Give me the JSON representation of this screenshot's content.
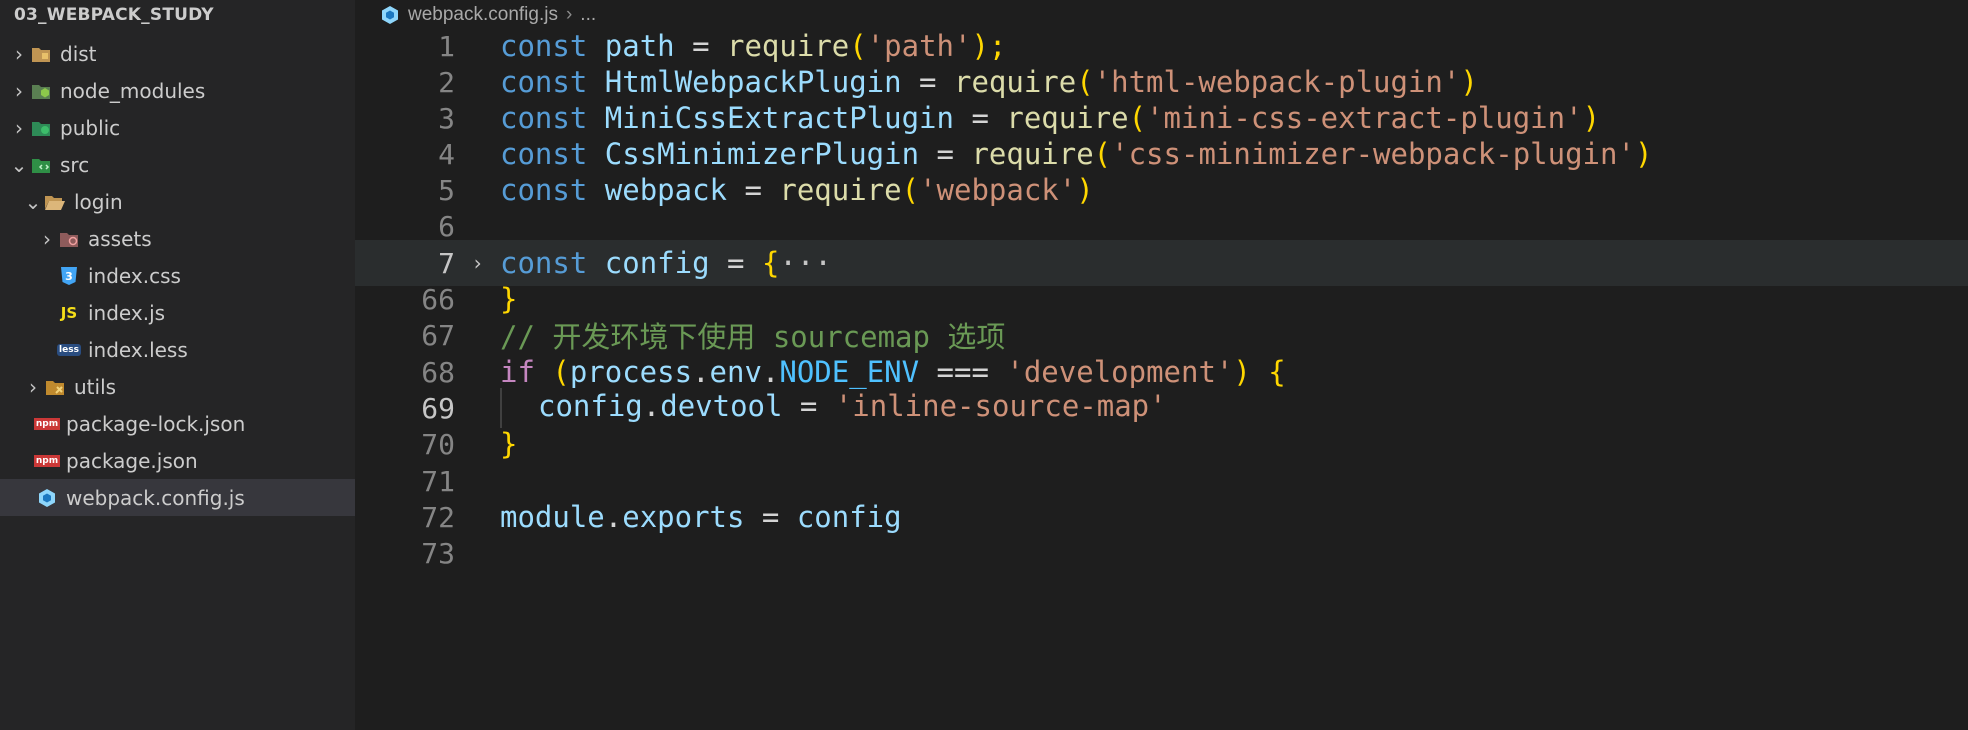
{
  "explorer": {
    "root_label": "03_WEBPACK_STUDY",
    "items": [
      {
        "label": "dist",
        "icon": "dist-folder-icon",
        "twisty": "›"
      },
      {
        "label": "node_modules",
        "icon": "node-modules-folder-icon",
        "twisty": "›"
      },
      {
        "label": "public",
        "icon": "public-folder-icon",
        "twisty": "›"
      },
      {
        "label": "src",
        "icon": "src-folder-icon",
        "twisty": "⌄"
      },
      {
        "label": "login",
        "icon": "folder-open-icon",
        "twisty": "⌄"
      },
      {
        "label": "assets",
        "icon": "assets-folder-icon",
        "twisty": "›"
      },
      {
        "label": "index.css",
        "icon": "css-file-icon",
        "icon_text": "3"
      },
      {
        "label": "index.js",
        "icon": "js-file-icon",
        "icon_text": "JS"
      },
      {
        "label": "index.less",
        "icon": "less-file-icon",
        "icon_text": "less"
      },
      {
        "label": "utils",
        "icon": "utils-folder-icon",
        "twisty": "›"
      },
      {
        "label": "package-lock.json",
        "icon": "npm-file-icon",
        "icon_text": "npm"
      },
      {
        "label": "package.json",
        "icon": "npm-file-icon",
        "icon_text": "npm"
      },
      {
        "label": "webpack.config.js",
        "icon": "webpack-file-icon"
      }
    ]
  },
  "breadcrumb": {
    "file": "webpack.config.js",
    "separator": "›",
    "more": "..."
  },
  "editor": {
    "lines": [
      {
        "num": "1",
        "t": [
          "const",
          " ",
          "path",
          " = ",
          "require",
          "(",
          "'path'",
          ");"
        ]
      },
      {
        "num": "2",
        "t": [
          "const",
          " ",
          "HtmlWebpackPlugin",
          " = ",
          "require",
          "(",
          "'html-webpack-plugin'",
          ")"
        ]
      },
      {
        "num": "3",
        "t": [
          "const",
          " ",
          "MiniCssExtractPlugin",
          " = ",
          "require",
          "(",
          "'mini-css-extract-plugin'",
          ")"
        ]
      },
      {
        "num": "4",
        "t": [
          "const",
          " ",
          "CssMinimizerPlugin",
          " = ",
          "require",
          "(",
          "'css-minimizer-webpack-plugin'",
          ")"
        ]
      },
      {
        "num": "5",
        "t": [
          "const",
          " ",
          "webpack",
          " = ",
          "require",
          "(",
          "'webpack'",
          ")"
        ]
      },
      {
        "num": "6",
        "t": []
      },
      {
        "num": "7",
        "fold": "›",
        "t": [
          "const",
          " ",
          "config",
          " = ",
          "{",
          "···"
        ]
      },
      {
        "num": "66",
        "t": [
          "}"
        ]
      },
      {
        "num": "67",
        "t": [
          "// 开发环境下使用 sourcemap 选项"
        ]
      },
      {
        "num": "68",
        "t": [
          "if",
          " (",
          "process",
          ".",
          "env",
          ".",
          "NODE_ENV",
          " === ",
          "'development'",
          ") ",
          "{"
        ]
      },
      {
        "num": "69",
        "t": [
          "config",
          ".",
          "devtool",
          " = ",
          "'inline-source-map'"
        ]
      },
      {
        "num": "70",
        "t": [
          "}"
        ]
      },
      {
        "num": "71",
        "t": []
      },
      {
        "num": "72",
        "t": [
          "module",
          ".",
          "exports",
          " = ",
          "config"
        ]
      },
      {
        "num": "73",
        "t": []
      }
    ]
  },
  "colors": {
    "background": "#1e1e1e",
    "sidebar": "#252526",
    "keyword": "#569cd6",
    "variable": "#9cdcfe",
    "function": "#dcdcaa",
    "string": "#ce9178",
    "comment": "#6a9955",
    "bracket": "#ffd700"
  }
}
